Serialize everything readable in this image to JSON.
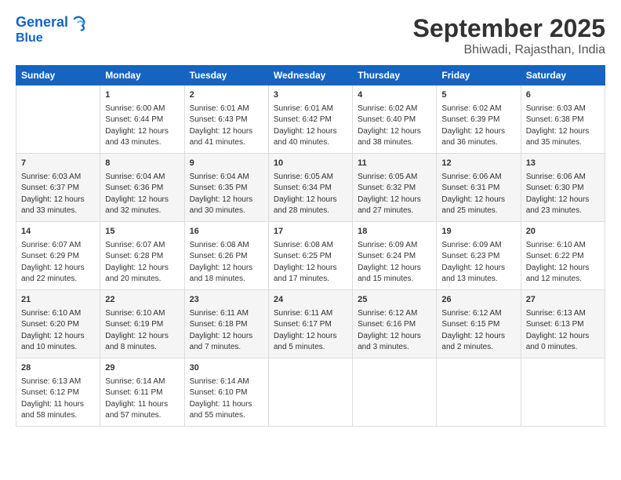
{
  "logo": {
    "line1": "General",
    "line2": "Blue"
  },
  "title": "September 2025",
  "subtitle": "Bhiwadi, Rajasthan, India",
  "headers": [
    "Sunday",
    "Monday",
    "Tuesday",
    "Wednesday",
    "Thursday",
    "Friday",
    "Saturday"
  ],
  "weeks": [
    [
      {
        "day": "",
        "info": ""
      },
      {
        "day": "1",
        "info": "Sunrise: 6:00 AM\nSunset: 6:44 PM\nDaylight: 12 hours\nand 43 minutes."
      },
      {
        "day": "2",
        "info": "Sunrise: 6:01 AM\nSunset: 6:43 PM\nDaylight: 12 hours\nand 41 minutes."
      },
      {
        "day": "3",
        "info": "Sunrise: 6:01 AM\nSunset: 6:42 PM\nDaylight: 12 hours\nand 40 minutes."
      },
      {
        "day": "4",
        "info": "Sunrise: 6:02 AM\nSunset: 6:40 PM\nDaylight: 12 hours\nand 38 minutes."
      },
      {
        "day": "5",
        "info": "Sunrise: 6:02 AM\nSunset: 6:39 PM\nDaylight: 12 hours\nand 36 minutes."
      },
      {
        "day": "6",
        "info": "Sunrise: 6:03 AM\nSunset: 6:38 PM\nDaylight: 12 hours\nand 35 minutes."
      }
    ],
    [
      {
        "day": "7",
        "info": "Sunrise: 6:03 AM\nSunset: 6:37 PM\nDaylight: 12 hours\nand 33 minutes."
      },
      {
        "day": "8",
        "info": "Sunrise: 6:04 AM\nSunset: 6:36 PM\nDaylight: 12 hours\nand 32 minutes."
      },
      {
        "day": "9",
        "info": "Sunrise: 6:04 AM\nSunset: 6:35 PM\nDaylight: 12 hours\nand 30 minutes."
      },
      {
        "day": "10",
        "info": "Sunrise: 6:05 AM\nSunset: 6:34 PM\nDaylight: 12 hours\nand 28 minutes."
      },
      {
        "day": "11",
        "info": "Sunrise: 6:05 AM\nSunset: 6:32 PM\nDaylight: 12 hours\nand 27 minutes."
      },
      {
        "day": "12",
        "info": "Sunrise: 6:06 AM\nSunset: 6:31 PM\nDaylight: 12 hours\nand 25 minutes."
      },
      {
        "day": "13",
        "info": "Sunrise: 6:06 AM\nSunset: 6:30 PM\nDaylight: 12 hours\nand 23 minutes."
      }
    ],
    [
      {
        "day": "14",
        "info": "Sunrise: 6:07 AM\nSunset: 6:29 PM\nDaylight: 12 hours\nand 22 minutes."
      },
      {
        "day": "15",
        "info": "Sunrise: 6:07 AM\nSunset: 6:28 PM\nDaylight: 12 hours\nand 20 minutes."
      },
      {
        "day": "16",
        "info": "Sunrise: 6:08 AM\nSunset: 6:26 PM\nDaylight: 12 hours\nand 18 minutes."
      },
      {
        "day": "17",
        "info": "Sunrise: 6:08 AM\nSunset: 6:25 PM\nDaylight: 12 hours\nand 17 minutes."
      },
      {
        "day": "18",
        "info": "Sunrise: 6:09 AM\nSunset: 6:24 PM\nDaylight: 12 hours\nand 15 minutes."
      },
      {
        "day": "19",
        "info": "Sunrise: 6:09 AM\nSunset: 6:23 PM\nDaylight: 12 hours\nand 13 minutes."
      },
      {
        "day": "20",
        "info": "Sunrise: 6:10 AM\nSunset: 6:22 PM\nDaylight: 12 hours\nand 12 minutes."
      }
    ],
    [
      {
        "day": "21",
        "info": "Sunrise: 6:10 AM\nSunset: 6:20 PM\nDaylight: 12 hours\nand 10 minutes."
      },
      {
        "day": "22",
        "info": "Sunrise: 6:10 AM\nSunset: 6:19 PM\nDaylight: 12 hours\nand 8 minutes."
      },
      {
        "day": "23",
        "info": "Sunrise: 6:11 AM\nSunset: 6:18 PM\nDaylight: 12 hours\nand 7 minutes."
      },
      {
        "day": "24",
        "info": "Sunrise: 6:11 AM\nSunset: 6:17 PM\nDaylight: 12 hours\nand 5 minutes."
      },
      {
        "day": "25",
        "info": "Sunrise: 6:12 AM\nSunset: 6:16 PM\nDaylight: 12 hours\nand 3 minutes."
      },
      {
        "day": "26",
        "info": "Sunrise: 6:12 AM\nSunset: 6:15 PM\nDaylight: 12 hours\nand 2 minutes."
      },
      {
        "day": "27",
        "info": "Sunrise: 6:13 AM\nSunset: 6:13 PM\nDaylight: 12 hours\nand 0 minutes."
      }
    ],
    [
      {
        "day": "28",
        "info": "Sunrise: 6:13 AM\nSunset: 6:12 PM\nDaylight: 11 hours\nand 58 minutes."
      },
      {
        "day": "29",
        "info": "Sunrise: 6:14 AM\nSunset: 6:11 PM\nDaylight: 11 hours\nand 57 minutes."
      },
      {
        "day": "30",
        "info": "Sunrise: 6:14 AM\nSunset: 6:10 PM\nDaylight: 11 hours\nand 55 minutes."
      },
      {
        "day": "",
        "info": ""
      },
      {
        "day": "",
        "info": ""
      },
      {
        "day": "",
        "info": ""
      },
      {
        "day": "",
        "info": ""
      }
    ]
  ]
}
